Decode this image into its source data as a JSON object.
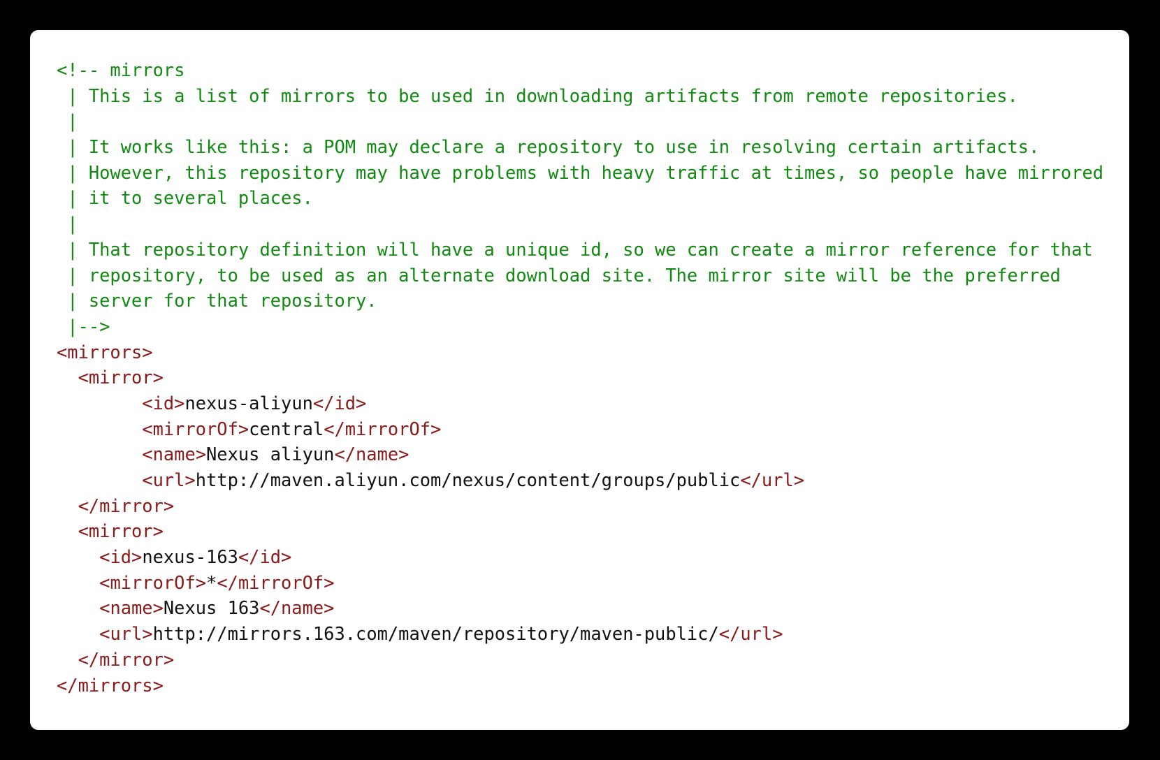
{
  "colors": {
    "background": "#000000",
    "panel": "#ffffff",
    "comment": "#108a10",
    "tag": "#8b1a1a",
    "text": "#111111"
  },
  "code_lines": [
    [
      {
        "k": "c",
        "t": "<!-- mirrors"
      }
    ],
    [
      {
        "k": "c",
        "t": " | This is a list of mirrors to be used in downloading artifacts from remote repositories."
      }
    ],
    [
      {
        "k": "c",
        "t": " |"
      }
    ],
    [
      {
        "k": "c",
        "t": " | It works like this: a POM may declare a repository to use in resolving certain artifacts."
      }
    ],
    [
      {
        "k": "c",
        "t": " | However, this repository may have problems with heavy traffic at times, so people have mirrored"
      }
    ],
    [
      {
        "k": "c",
        "t": " | it to several places."
      }
    ],
    [
      {
        "k": "c",
        "t": " |"
      }
    ],
    [
      {
        "k": "c",
        "t": " | That repository definition will have a unique id, so we can create a mirror reference for that"
      }
    ],
    [
      {
        "k": "c",
        "t": " | repository, to be used as an alternate download site. The mirror site will be the preferred"
      }
    ],
    [
      {
        "k": "c",
        "t": " | server for that repository."
      }
    ],
    [
      {
        "k": "c",
        "t": " |-->"
      }
    ],
    [
      {
        "k": "t",
        "t": "<mirrors>"
      }
    ],
    [
      {
        "k": "x",
        "t": "  "
      },
      {
        "k": "t",
        "t": "<mirror>"
      }
    ],
    [
      {
        "k": "x",
        "t": "        "
      },
      {
        "k": "t",
        "t": "<id>"
      },
      {
        "k": "x",
        "t": "nexus-aliyun"
      },
      {
        "k": "t",
        "t": "</id>"
      }
    ],
    [
      {
        "k": "x",
        "t": "        "
      },
      {
        "k": "t",
        "t": "<mirrorOf>"
      },
      {
        "k": "x",
        "t": "central"
      },
      {
        "k": "t",
        "t": "</mirrorOf>"
      }
    ],
    [
      {
        "k": "x",
        "t": "        "
      },
      {
        "k": "t",
        "t": "<name>"
      },
      {
        "k": "x",
        "t": "Nexus aliyun"
      },
      {
        "k": "t",
        "t": "</name>"
      }
    ],
    [
      {
        "k": "x",
        "t": "        "
      },
      {
        "k": "t",
        "t": "<url>"
      },
      {
        "k": "x",
        "t": "http://maven.aliyun.com/nexus/content/groups/public"
      },
      {
        "k": "t",
        "t": "</url>"
      }
    ],
    [
      {
        "k": "x",
        "t": "  "
      },
      {
        "k": "t",
        "t": "</mirror>"
      }
    ],
    [
      {
        "k": "x",
        "t": "  "
      },
      {
        "k": "t",
        "t": "<mirror>"
      }
    ],
    [
      {
        "k": "x",
        "t": "    "
      },
      {
        "k": "t",
        "t": "<id>"
      },
      {
        "k": "x",
        "t": "nexus-163"
      },
      {
        "k": "t",
        "t": "</id>"
      }
    ],
    [
      {
        "k": "x",
        "t": "    "
      },
      {
        "k": "t",
        "t": "<mirrorOf>"
      },
      {
        "k": "x",
        "t": "*"
      },
      {
        "k": "t",
        "t": "</mirrorOf>"
      }
    ],
    [
      {
        "k": "x",
        "t": "    "
      },
      {
        "k": "t",
        "t": "<name>"
      },
      {
        "k": "x",
        "t": "Nexus 163"
      },
      {
        "k": "t",
        "t": "</name>"
      }
    ],
    [
      {
        "k": "x",
        "t": "    "
      },
      {
        "k": "t",
        "t": "<url>"
      },
      {
        "k": "x",
        "t": "http://mirrors.163.com/maven/repository/maven-public/"
      },
      {
        "k": "t",
        "t": "</url>"
      }
    ],
    [
      {
        "k": "x",
        "t": "  "
      },
      {
        "k": "t",
        "t": "</mirror>"
      }
    ],
    [
      {
        "k": "t",
        "t": "</mirrors>"
      }
    ]
  ]
}
